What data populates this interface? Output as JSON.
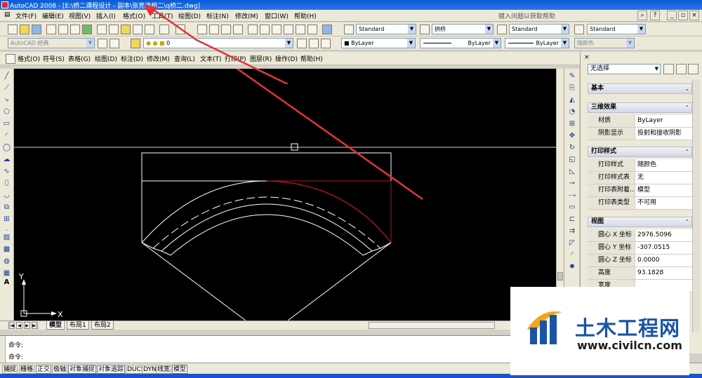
{
  "window": {
    "title": "AutoCAD 2008 - [E:\\桥二课程设计 - 副本\\张亮清桥二\\q桥二.dwg]"
  },
  "menubar": {
    "items": [
      "文件(F)",
      "编辑(E)",
      "视图(V)",
      "插入(I)",
      "格式(O)",
      "工具(T)",
      "绘图(D)",
      "标注(N)",
      "修改(M)",
      "窗口(W)",
      "帮助(H)"
    ],
    "help_placeholder": "键入问题以获取帮助"
  },
  "toolbar_styles": {
    "text_style": "Standard",
    "dim_style": "拱桥",
    "table_style": "Standard",
    "multileader_style": "Standard"
  },
  "toolbar_layers": {
    "workspace": "AutoCAD 经典",
    "layer": "0",
    "color": "ByLayer",
    "linetype": "ByLayer",
    "lineweight": "ByLayer",
    "plotstyle": "随颜色"
  },
  "toolbar_menu": {
    "items": [
      "格式(O)",
      "符号(S)",
      "表格(G)",
      "绘图(D)",
      "标注(D)",
      "修改(M)",
      "查询(L)",
      "文本(T)",
      "打印(P)",
      "图层(R)",
      "操作(D)",
      "帮助(H)"
    ]
  },
  "layout_tabs": {
    "tabs": [
      "模型",
      "布局1",
      "布局2"
    ],
    "active": "模型"
  },
  "ucs": {
    "x_label": "X",
    "y_label": "Y"
  },
  "properties": {
    "selection": "无选择",
    "sections": {
      "basic": "基本",
      "three_d": "三维效果",
      "plot": "打印样式",
      "view": "视图"
    },
    "three_d_rows": [
      {
        "key": "材质",
        "value": "ByLayer"
      },
      {
        "key": "阴影显示",
        "value": "投射和接收阴影"
      }
    ],
    "plot_rows": [
      {
        "key": "打印样式",
        "value": "随颜色"
      },
      {
        "key": "打印样式表",
        "value": "无"
      },
      {
        "key": "打印表附着...",
        "value": "模型"
      },
      {
        "key": "打印表类型",
        "value": "不可用"
      }
    ],
    "view_rows": [
      {
        "key": "圆心 X 坐标",
        "value": "2976.5096"
      },
      {
        "key": "圆心 Y 坐标",
        "value": "-307.0515"
      },
      {
        "key": "圆心 Z 坐标",
        "value": "0.0000"
      },
      {
        "key": "高度",
        "value": "93.1828"
      },
      {
        "key": "宽度",
        "value": ""
      }
    ]
  },
  "command": {
    "line1": "命令:",
    "line2": "命令:"
  },
  "statusbar": {
    "toggles": [
      "捕捉",
      "栅格",
      "正交",
      "极轴",
      "对象捕捉",
      "对象追踪",
      "DUCS",
      "DYN",
      "线宽",
      "模型"
    ],
    "on": [
      "正交",
      "对象捕捉",
      "对象追踪",
      "模型"
    ]
  },
  "watermark": {
    "title": "土木工程网",
    "url": "www.civilcn.com"
  },
  "colors": {
    "canvas": "#000000",
    "annotation_arrow": "#e0343a",
    "selected_arc": "#b01820",
    "brand_blue": "#1b53a7"
  }
}
